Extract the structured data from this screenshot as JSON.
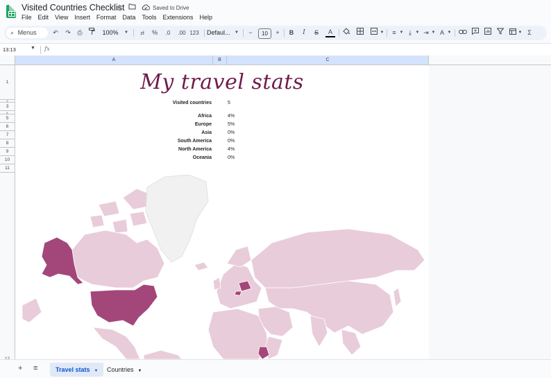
{
  "app": {
    "doc_title": "Visited Countries Checklist",
    "saved_status": "Saved to Drive",
    "menu": [
      "File",
      "Edit",
      "View",
      "Insert",
      "Format",
      "Data",
      "Tools",
      "Extensions",
      "Help"
    ]
  },
  "toolbar": {
    "menus_label": "Menus",
    "zoom": "100%",
    "percent": "%",
    "dec_decrease": ".0",
    "dec_increase": ".00",
    "number_format": "123",
    "font": "Defaul...",
    "font_size": "10",
    "currency": "zł"
  },
  "formula_bar": {
    "name_box": "13:13",
    "fx": "fx"
  },
  "columns": [
    "A",
    "B",
    "C"
  ],
  "rows": [
    "1",
    "2",
    "3",
    "4",
    "5",
    "6",
    "7",
    "8",
    "9",
    "10",
    "11",
    "12"
  ],
  "sheet": {
    "title": "My travel stats",
    "visited_label": "Visited countries",
    "visited_value": "5",
    "continents": [
      {
        "name": "Africa",
        "value": "4%"
      },
      {
        "name": "Europe",
        "value": "5%"
      },
      {
        "name": "Asia",
        "value": "0%"
      },
      {
        "name": "South America",
        "value": "0%"
      },
      {
        "name": "North America",
        "value": "4%"
      },
      {
        "name": "Oceania",
        "value": "0%"
      }
    ],
    "map": {
      "base_color": "#e9ccd9",
      "visited_color": "#a3477a",
      "border_color": "#ffffff",
      "greenland_color": "#f1f1f1"
    }
  },
  "sheet_tabs": [
    {
      "label": "Travel stats",
      "active": true
    },
    {
      "label": "Countries",
      "active": false
    }
  ]
}
